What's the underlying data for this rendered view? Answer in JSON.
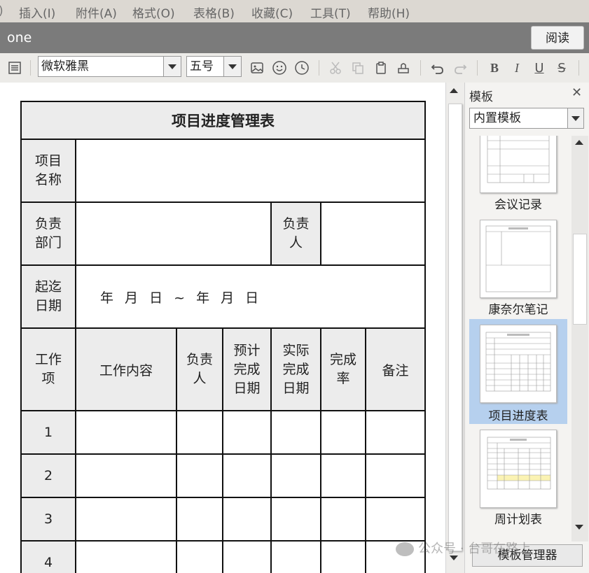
{
  "menu": {
    "items": [
      "插入(I)",
      "附件(A)",
      "格式(O)",
      "表格(B)",
      "收藏(C)",
      "工具(T)",
      "帮助(H)"
    ]
  },
  "window": {
    "title": "one",
    "read_button": "阅读"
  },
  "toolbar": {
    "font_name": "微软雅黑",
    "font_size": "五号",
    "icons": [
      "list-icon",
      "image-icon",
      "emoji-icon",
      "clock-icon",
      "cut-icon",
      "copy-icon",
      "paste-icon",
      "format-painter-icon",
      "undo-icon",
      "redo-icon",
      "bold-icon",
      "italic-icon",
      "underline-icon",
      "strikethrough-icon"
    ],
    "bold": "B",
    "italic": "I",
    "underline": "U",
    "strike": "S"
  },
  "doc": {
    "table_title": "项目进度管理表",
    "row_labels": {
      "project_name": "项目名称",
      "department": "负责部门",
      "owner": "负责人",
      "dates": "起迄日期"
    },
    "date_text": "年 月 日 ~ 年 月 日",
    "headers": [
      "工作项",
      "工作内容",
      "负责人",
      "预计完成日期",
      "实际完成日期",
      "完成率",
      "备注"
    ],
    "rows": [
      "1",
      "2",
      "3",
      "4"
    ]
  },
  "panel": {
    "title": "模板",
    "select_value": "内置模板",
    "templates": [
      {
        "label": "会议记录",
        "selected": false
      },
      {
        "label": "康奈尔笔记",
        "selected": false
      },
      {
        "label": "项目进度表",
        "selected": true
      },
      {
        "label": "周计划表",
        "selected": false
      }
    ],
    "manager_button": "模板管理器"
  },
  "watermark": "公众号 · 台哥在路上",
  "colors": {
    "selected_bg": "#b6d0ee",
    "title_bar": "#7b7b7b",
    "header_shade": "#ececec"
  }
}
